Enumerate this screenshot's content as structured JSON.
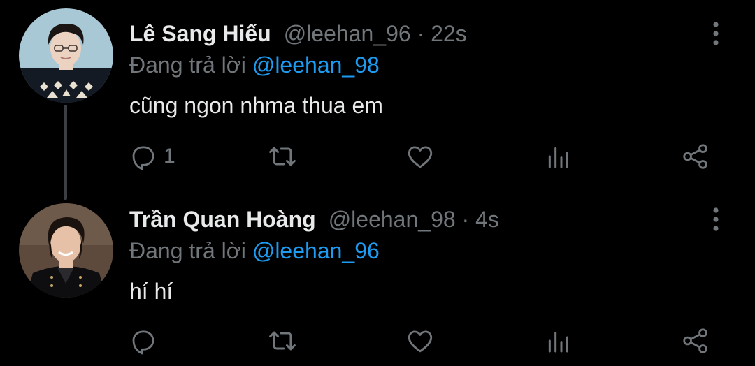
{
  "tweets": [
    {
      "name": "Lê Sang Hiếu",
      "handle_time": "@leehan_96 · 22s",
      "reply_prefix": "Đang trả lời",
      "reply_to": "@leehan_98",
      "text": "cũng ngon nhma thua em",
      "reply_count": "1",
      "avatar_colors": {
        "bg": "#a9c8d6",
        "hair": "#1b1614",
        "skin": "#ecd2c0",
        "sweater": "#141a24",
        "pattern": "#e8e0d0"
      }
    },
    {
      "name": "Trần Quan Hoàng",
      "handle_time": "@leehan_98 · 4s",
      "reply_prefix": "Đang trả lời",
      "reply_to": "@leehan_96",
      "text": "hí hí",
      "reply_count": "",
      "avatar_colors": {
        "bg": "#5d4a3c",
        "hair": "#1a120e",
        "skin": "#e6c1a8",
        "jacket": "#0e0e10"
      }
    }
  ],
  "icons": [
    "reply-icon",
    "retweet-icon",
    "like-icon",
    "views-icon",
    "share-icon",
    "more-options-icon"
  ],
  "colors": {
    "background": "#000000",
    "primary_text": "#e7e9ea",
    "secondary_text": "#71767b",
    "accent": "#1d9bf0",
    "thread_line": "#3b3f44"
  }
}
